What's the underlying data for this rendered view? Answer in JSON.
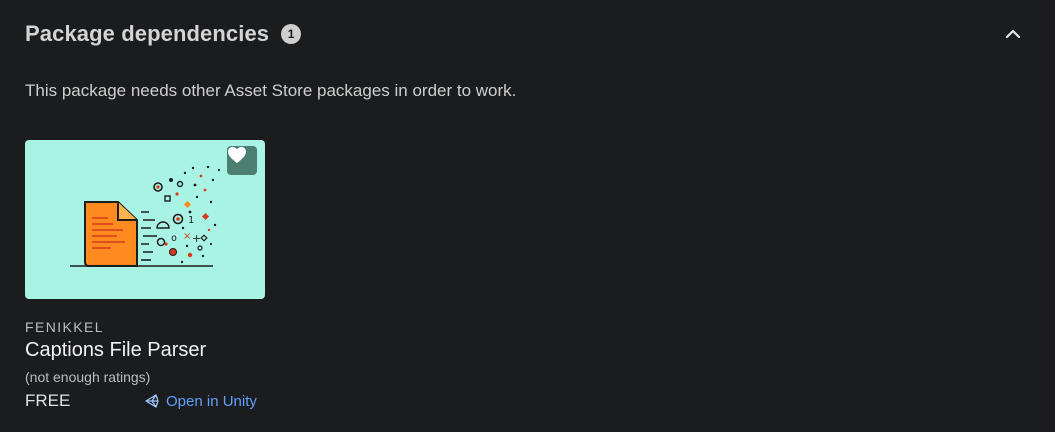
{
  "section": {
    "title": "Package dependencies",
    "count": "1",
    "description": "This package needs other Asset Store packages in order to work."
  },
  "icons": {
    "collapse": "chevron-up-icon",
    "favorite": "heart-icon",
    "open": "unity-logo-icon"
  },
  "package": {
    "publisher": "FENIKKEL",
    "title": "Captions File Parser",
    "ratings": "(not enough ratings)",
    "price": "FREE",
    "open_label": "Open in Unity"
  },
  "colors": {
    "background": "#1b1c1e",
    "thumbnail_bg": "#a8f3e3",
    "link": "#5fa0ff",
    "favorite_bg": "#4a7f72"
  }
}
